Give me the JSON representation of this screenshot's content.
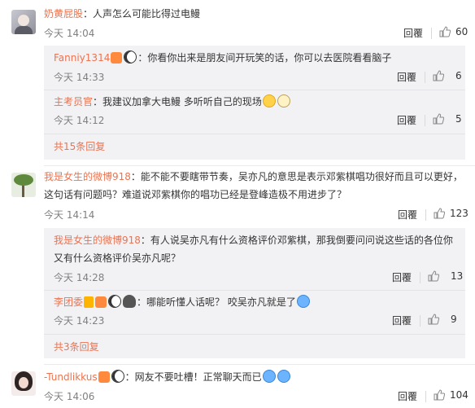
{
  "comments": [
    {
      "user": "奶黄屁股",
      "text": "：人声怎么可能比得过电鳗",
      "time": "今天 14:04",
      "reply_label": "回覆",
      "likes": "60",
      "replies": [
        {
          "user": "Fanniy1314",
          "text": "：你看你出来是朋友间开玩笑的话，你可以去医院看看脑子",
          "time": "今天 14:33",
          "reply_label": "回覆",
          "likes": "6"
        },
        {
          "user": "主考员官",
          "text": "：我建议加拿大电鳗 多听听自己的现场",
          "time": "今天 14:12",
          "reply_label": "回覆",
          "likes": "5"
        }
      ],
      "more": "共15条回复"
    },
    {
      "user": "我是女生的微博918",
      "text": "：能不能不要瞎带节奏，吴亦凡的意思是表示邓紫棋唱功很好而且可以更好，这句话有问题吗？难道说邓紫棋你的唱功已经是登峰造极不用进步了？",
      "time": "今天 14:14",
      "reply_label": "回覆",
      "likes": "123",
      "replies": [
        {
          "user": "我是女生的微博918",
          "text": "：有人说吴亦凡有什么资格评价邓紫棋，那我倒要问问说这些话的各位你又有什么资格评价吴亦凡呢？",
          "time": "今天 14:28",
          "reply_label": "回覆",
          "likes": "13"
        },
        {
          "user": "李团委",
          "text": "：哪能听懂人话呢？ 咬吴亦凡就是了",
          "time": "今天 14:23",
          "reply_label": "回覆",
          "likes": "9"
        }
      ],
      "more": "共3条回复"
    },
    {
      "user": "-Tundlikkus",
      "text": "：网友不要吐槽！正常聊天而已",
      "time": "今天 14:06",
      "reply_label": "回覆",
      "likes": "104"
    }
  ]
}
